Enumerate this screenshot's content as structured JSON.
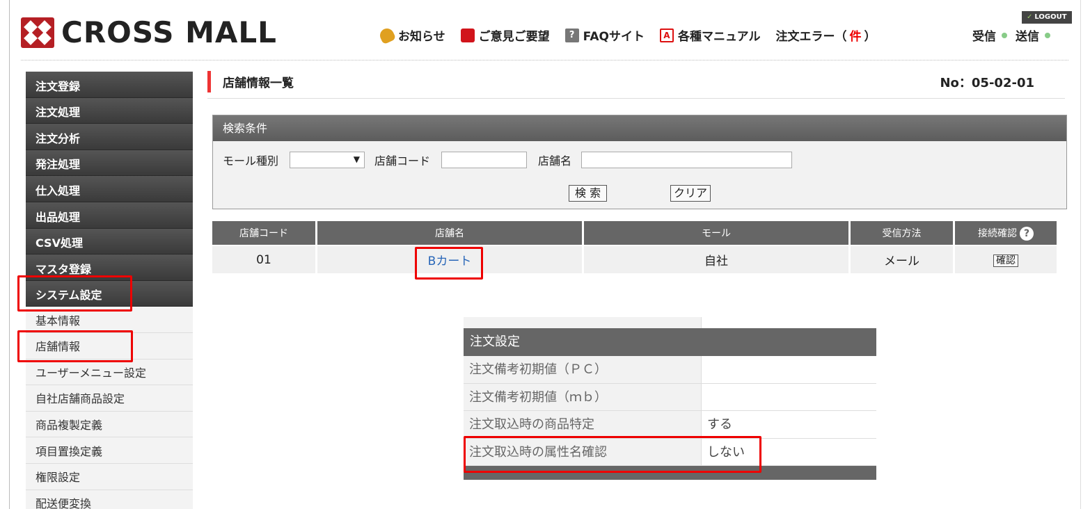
{
  "header": {
    "brand": "CROSS MALL",
    "logout_label": "LOGOUT",
    "nav": [
      {
        "label": "お知らせ",
        "icon": "bell-icon"
      },
      {
        "label": "ご意見ご要望",
        "icon": "mailbox-icon"
      },
      {
        "label": "FAQサイト",
        "icon": "help-icon"
      },
      {
        "label": "各種マニュアル",
        "icon": "pdf-icon"
      }
    ],
    "order_error_prefix": "注文エラー（",
    "order_error_count": "件",
    "order_error_suffix": "）",
    "receive_label": "受信",
    "send_label": "送信"
  },
  "sidebar": {
    "main_menu": [
      "注文登録",
      "注文処理",
      "注文分析",
      "発注処理",
      "仕入処理",
      "出品処理",
      "CSV処理",
      "マスタ登録",
      "システム設定"
    ],
    "sub_menu": [
      "基本情報",
      "店舗情報",
      "ユーザーメニュー設定",
      "自社店舗商品設定",
      "商品複製定義",
      "項目置換定義",
      "権限設定",
      "配送便変換"
    ]
  },
  "page": {
    "title": "店舗情報一覧",
    "number": "No：05-02-01"
  },
  "search": {
    "heading": "検索条件",
    "mall_type_label": "モール種別",
    "mall_type_value": "",
    "store_code_label": "店舗コード",
    "store_code_value": "",
    "store_name_label": "店舗名",
    "store_name_value": "",
    "search_button": "検 索",
    "clear_button": "クリア"
  },
  "results": {
    "columns": [
      "店舗コード",
      "店舗名",
      "モール",
      "受信方法",
      "接続確認"
    ],
    "help_glyph": "?",
    "rows": [
      {
        "code": "01",
        "name": "Bカート",
        "mall": "自社",
        "method": "メール",
        "check_label": "確認"
      }
    ]
  },
  "order_settings": {
    "heading": "注文設定",
    "rows": [
      {
        "key": "注文備考初期値（ＰＣ）",
        "value": ""
      },
      {
        "key": "注文備考初期値（ｍｂ）",
        "value": ""
      },
      {
        "key": "注文取込時の商品特定",
        "value": "する"
      },
      {
        "key": "注文取込時の属性名確認",
        "value": "しない"
      }
    ]
  },
  "colors": {
    "highlight": "#e00000",
    "accent": "#e33333",
    "link": "#2866b8"
  }
}
